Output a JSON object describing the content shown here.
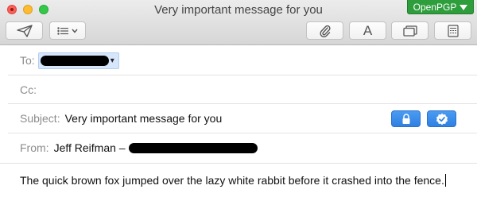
{
  "window": {
    "title": "Very important message for you",
    "openpgp_label": "OpenPGP",
    "colors": {
      "close": "#fc5f57",
      "minimize": "#fdbc2e",
      "zoom": "#34c84a",
      "openpgp": "#2e9d3c",
      "security_button": "#3a8ae8"
    }
  },
  "toolbar": {
    "icons": [
      "paper-plane-icon",
      "list-icon",
      "paperclip-icon",
      "font-icon",
      "photo-browser-icon",
      "format-bar-icon"
    ],
    "font_label": "A"
  },
  "header": {
    "to_label": "To:",
    "cc_label": "Cc:",
    "subject_label": "Subject:",
    "subject_value": "Very important message for you",
    "from_label": "From:",
    "from_name": "Jeff Reifman –"
  },
  "body": {
    "text": "The quick brown fox jumped over the lazy white rabbit before it crashed into the fence."
  }
}
